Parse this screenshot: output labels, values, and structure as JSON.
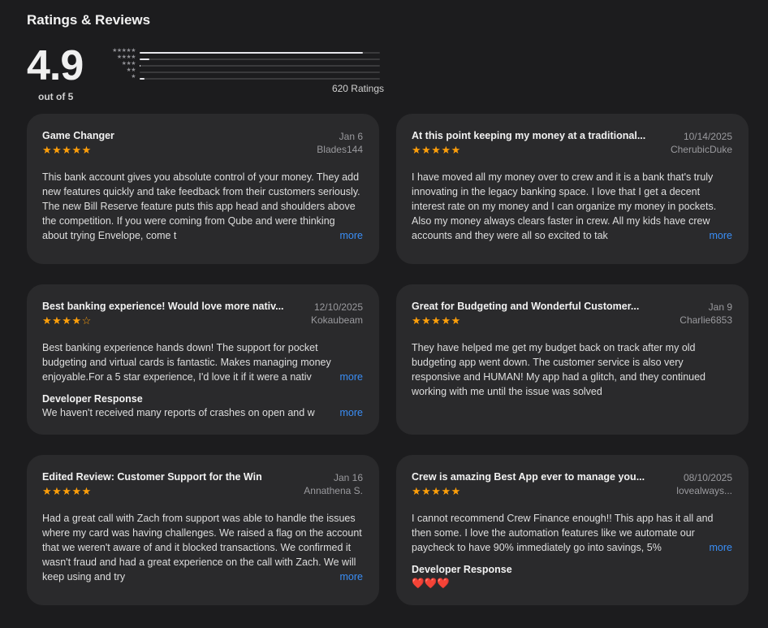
{
  "section": {
    "title": "Ratings & Reviews"
  },
  "summary": {
    "score": "4.9",
    "out_of": "out of 5",
    "ratings_count": "620 Ratings",
    "histogram": [
      {
        "stars": "★★★★★",
        "fraction": 0.93
      },
      {
        "stars": "★★★★",
        "fraction": 0.04
      },
      {
        "stars": "★★★",
        "fraction": 0.005
      },
      {
        "stars": "★★",
        "fraction": 0.0
      },
      {
        "stars": "★",
        "fraction": 0.02
      }
    ]
  },
  "reviews": [
    {
      "title": "Game Changer",
      "date": "Jan 6",
      "author": "Blades144",
      "stars": "★★★★★",
      "rating": 5,
      "body": "This bank account gives you absolute control of your money. They add new features quickly and take feedback from their customers seriously. The new Bill Reserve feature puts this app head and shoulders above the competition. If you were coming from Qube and were thinking about trying Envelope, come t",
      "more": "more"
    },
    {
      "title": "At this point keeping my money at a traditional...",
      "date": "10/14/2025",
      "author": "CherubicDuke",
      "stars": "★★★★★",
      "rating": 5,
      "body": "I have moved all my money over to crew and it is a bank that's truly innovating in the legacy banking space. I love that I get a decent interest rate on my money and I can organize my money in pockets. Also my money always clears faster in crew. All my kids have crew accounts and they were all so excited to tak",
      "more": "more"
    },
    {
      "title": "Best banking experience! Would love more nativ...",
      "date": "12/10/2025",
      "author": "Kokaubeam",
      "stars": "★★★★☆",
      "rating": 4,
      "body": "Best banking experience hands down! The support for pocket budgeting and virtual cards is fantastic. Makes managing money enjoyable.For a 5 star experience, I'd love it if it were a nativ",
      "more": "more",
      "developer_response": {
        "label": "Developer Response",
        "text": "We haven't received many reports of crashes on open and w",
        "more": "more"
      }
    },
    {
      "title": "Great for Budgeting and Wonderful Customer...",
      "date": "Jan 9",
      "author": "Charlie6853",
      "stars": "★★★★★",
      "rating": 5,
      "body": "They have helped me get my budget back on track after my old budgeting app went down. The customer service is also very responsive and HUMAN! My app had a glitch, and they continued working with me until the issue was solved"
    },
    {
      "title": "Edited Review: Customer Support for the Win",
      "date": "Jan 16",
      "author": "Annathena S.",
      "stars": "★★★★★",
      "rating": 5,
      "body": "Had a great call with Zach from support was able to handle the issues where my card was having challenges. We raised a flag on the account that we weren't aware of and it blocked transactions. We confirmed it wasn't fraud and had a great experience on the call with Zach. We will keep using and try",
      "more": "more"
    },
    {
      "title": "Crew is amazing Best App ever to manage you...",
      "date": "08/10/2025",
      "author": "lovealways...",
      "stars": "★★★★★",
      "rating": 5,
      "body": "I cannot recommend Crew Finance enough!! This app has it all and then some. I love the automation features like we automate our paycheck to have 90% immediately go into savings, 5%",
      "more": "more",
      "developer_response": {
        "label": "Developer Response",
        "text": "❤️❤️❤️"
      }
    }
  ]
}
